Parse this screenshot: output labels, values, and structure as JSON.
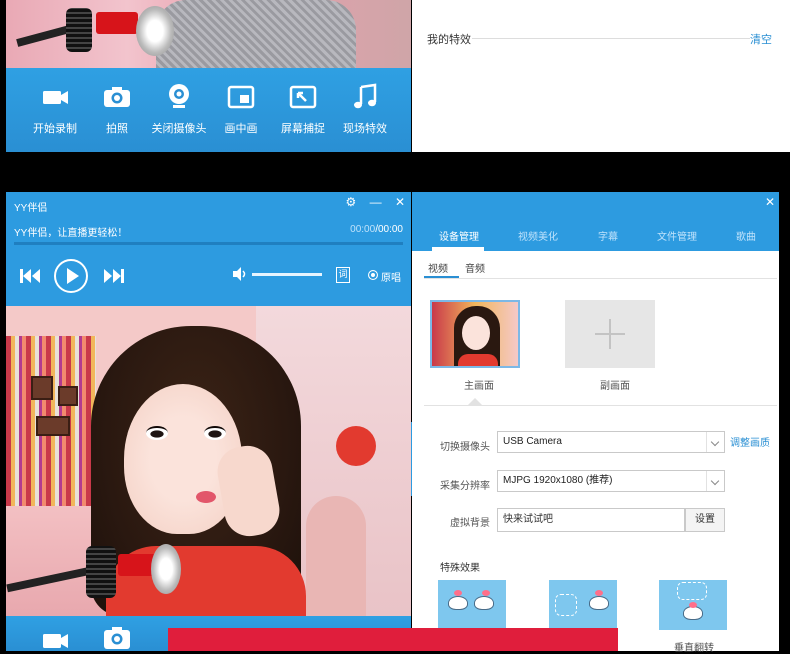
{
  "top": {
    "toolbar": [
      {
        "label": "开始录制",
        "icon": "video-camera-icon"
      },
      {
        "label": "拍照",
        "icon": "photo-camera-icon"
      },
      {
        "label": "关闭摄像头",
        "icon": "webcam-icon"
      },
      {
        "label": "画中画",
        "icon": "picture-in-picture-icon"
      },
      {
        "label": "屏幕捕捉",
        "icon": "screen-capture-icon"
      },
      {
        "label": "现场特效",
        "icon": "music-note-icon"
      }
    ],
    "my_effects_label": "我的特效",
    "clear_label": "清空"
  },
  "player": {
    "app_title": "YY伴侣",
    "track_title": "YY伴侣，让直播更轻松！",
    "time_current": "00:00",
    "time_total": "/00:00",
    "lyric_label": "词",
    "original_label": "原唱"
  },
  "settings": {
    "tabs": [
      "设备管理",
      "视频美化",
      "字幕",
      "文件管理",
      "歌曲"
    ],
    "active_tab": 0,
    "subtabs": [
      "视频",
      "音频"
    ],
    "main_screen_label": "主画面",
    "sub_screen_label": "副画面",
    "camera_label": "切换摄像头",
    "camera_value": "USB Camera",
    "adjust_label": "调整画质",
    "resolution_label": "采集分辨率",
    "resolution_value": "MJPG 1920x1080 (推荐)",
    "virtual_bg_label": "虚拟背景",
    "virtual_bg_value": "快来试试吧",
    "set_label": "设置",
    "special_effects_label": "特殊效果",
    "flip_vertical_label": "垂直翻转"
  },
  "colors": {
    "accent": "#2d9be0",
    "banner": "#e01e3c"
  }
}
